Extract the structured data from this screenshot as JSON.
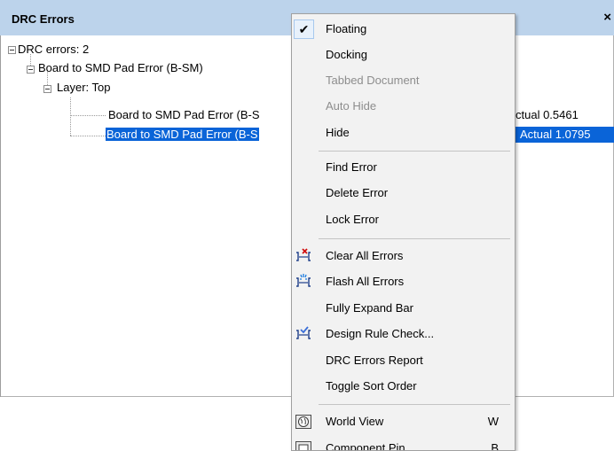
{
  "panel": {
    "title": "DRC Errors",
    "close_glyph": "×",
    "tree": {
      "root": "DRC errors: 2",
      "rule": "Board to SMD Pad Error (B-SM)",
      "layer": "Layer: Top",
      "errors": [
        {
          "label": "Board to SMD Pad Error (B-S",
          "tail": "ctual 0.5461",
          "selected": false
        },
        {
          "label": "Board to SMD Pad Error (B-S",
          "tail": "Actual 1.0795",
          "selected": true
        }
      ]
    }
  },
  "menu": {
    "items": [
      {
        "label": "Floating",
        "checked": true
      },
      {
        "label": "Docking"
      },
      {
        "label": "Tabbed Document",
        "disabled": true
      },
      {
        "label": "Auto Hide",
        "disabled": true
      },
      {
        "label": "Hide"
      },
      {
        "label": "Find Error"
      },
      {
        "label": "Delete Error"
      },
      {
        "label": "Lock Error"
      },
      {
        "label": "Clear All Errors",
        "icon": "clear-errors-icon"
      },
      {
        "label": "Flash All Errors",
        "icon": "flash-errors-icon"
      },
      {
        "label": "Fully Expand Bar"
      },
      {
        "label": "Design Rule Check...",
        "icon": "design-rule-check-icon"
      },
      {
        "label": "DRC Errors Report"
      },
      {
        "label": "Toggle Sort Order"
      },
      {
        "label": "World View",
        "icon": "world-view-icon",
        "shortcut": "W"
      },
      {
        "label": "Component Pin",
        "icon": "component-pin-icon",
        "shortcut": "B"
      }
    ]
  },
  "colors": {
    "selection": "#0a64d8",
    "titlebar": "#bcd3eb",
    "menu_bg": "#f2f2f2"
  }
}
